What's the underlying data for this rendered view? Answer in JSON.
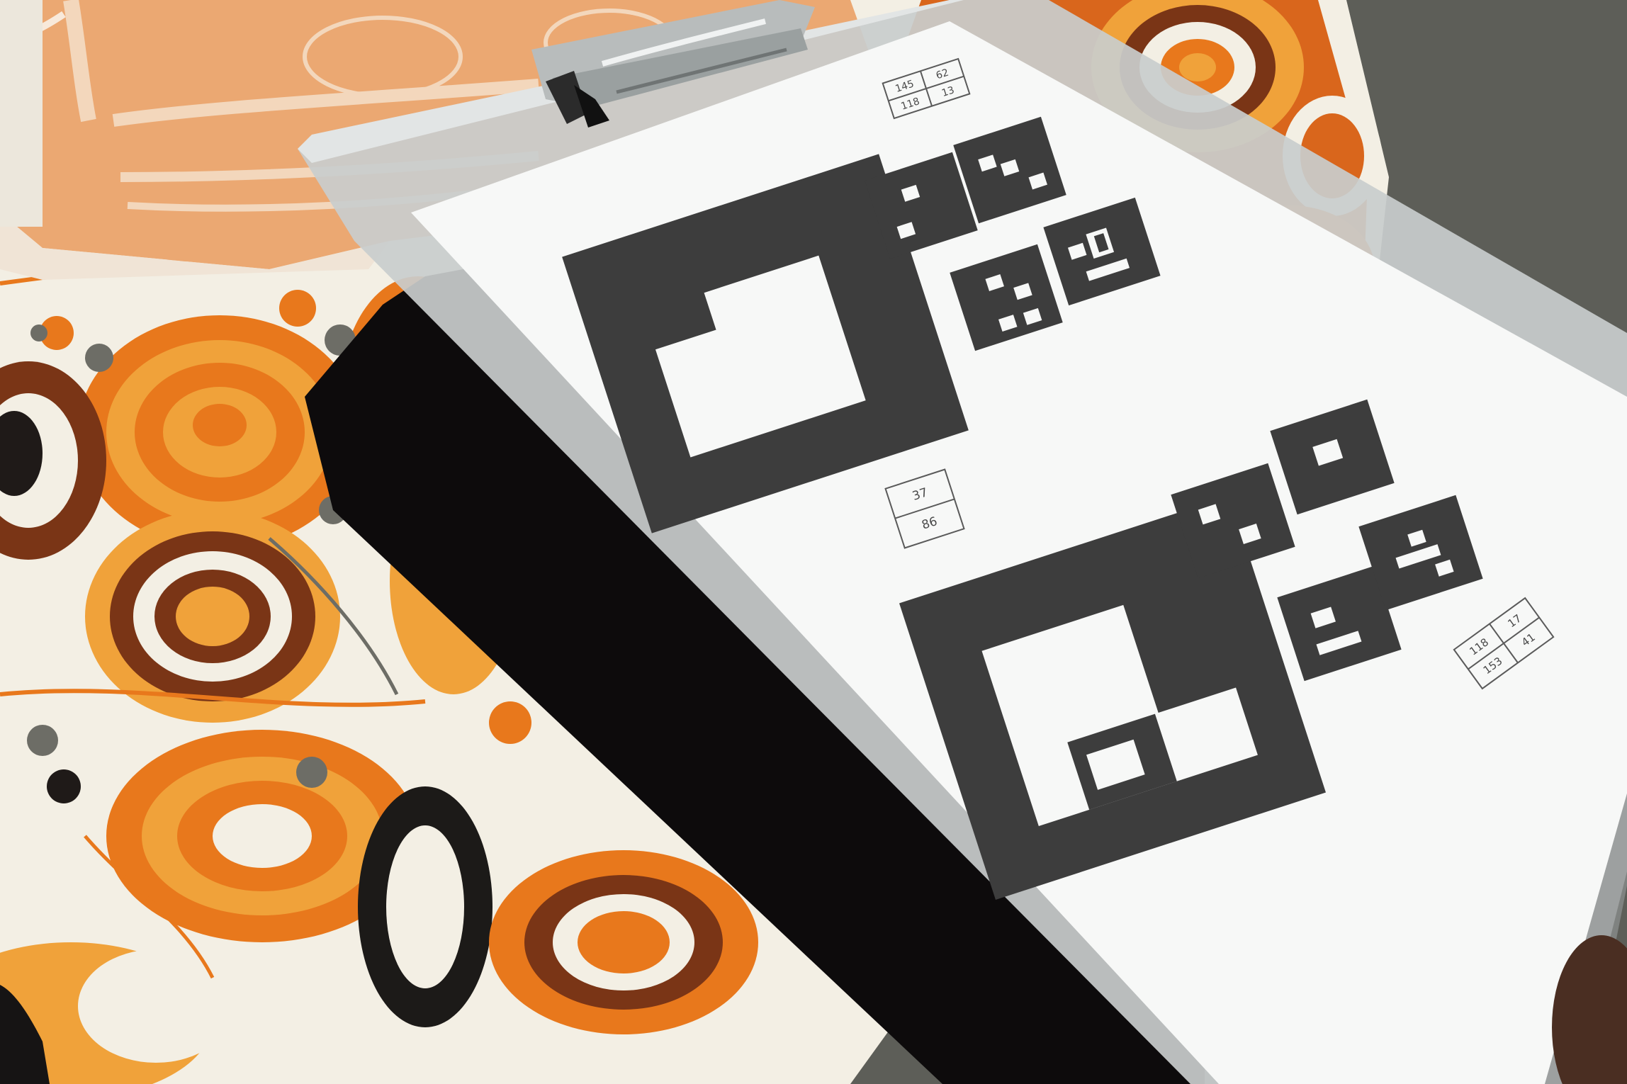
{
  "colors": {
    "fabric_base": "#f3efe4",
    "fabric_orange": "#e8781c",
    "fabric_light_orange": "#f0a23a",
    "fabric_brown": "#7a3516",
    "fabric_gray": "#6d6d66",
    "towel": "#eba872",
    "towel_stripe": "#f3d7bc",
    "mat_black": "#0d0b0c",
    "clipboard": "#cfd3d3",
    "paper": "#f7f8f7",
    "marker_ink": "#3d3d3d",
    "floor": "#5d5e58"
  },
  "codes": {
    "top_right": [
      "145",
      "62",
      "118",
      "13"
    ],
    "center": [
      "37",
      "86"
    ],
    "bottom_right": [
      "118",
      "17",
      "153",
      "41"
    ]
  }
}
